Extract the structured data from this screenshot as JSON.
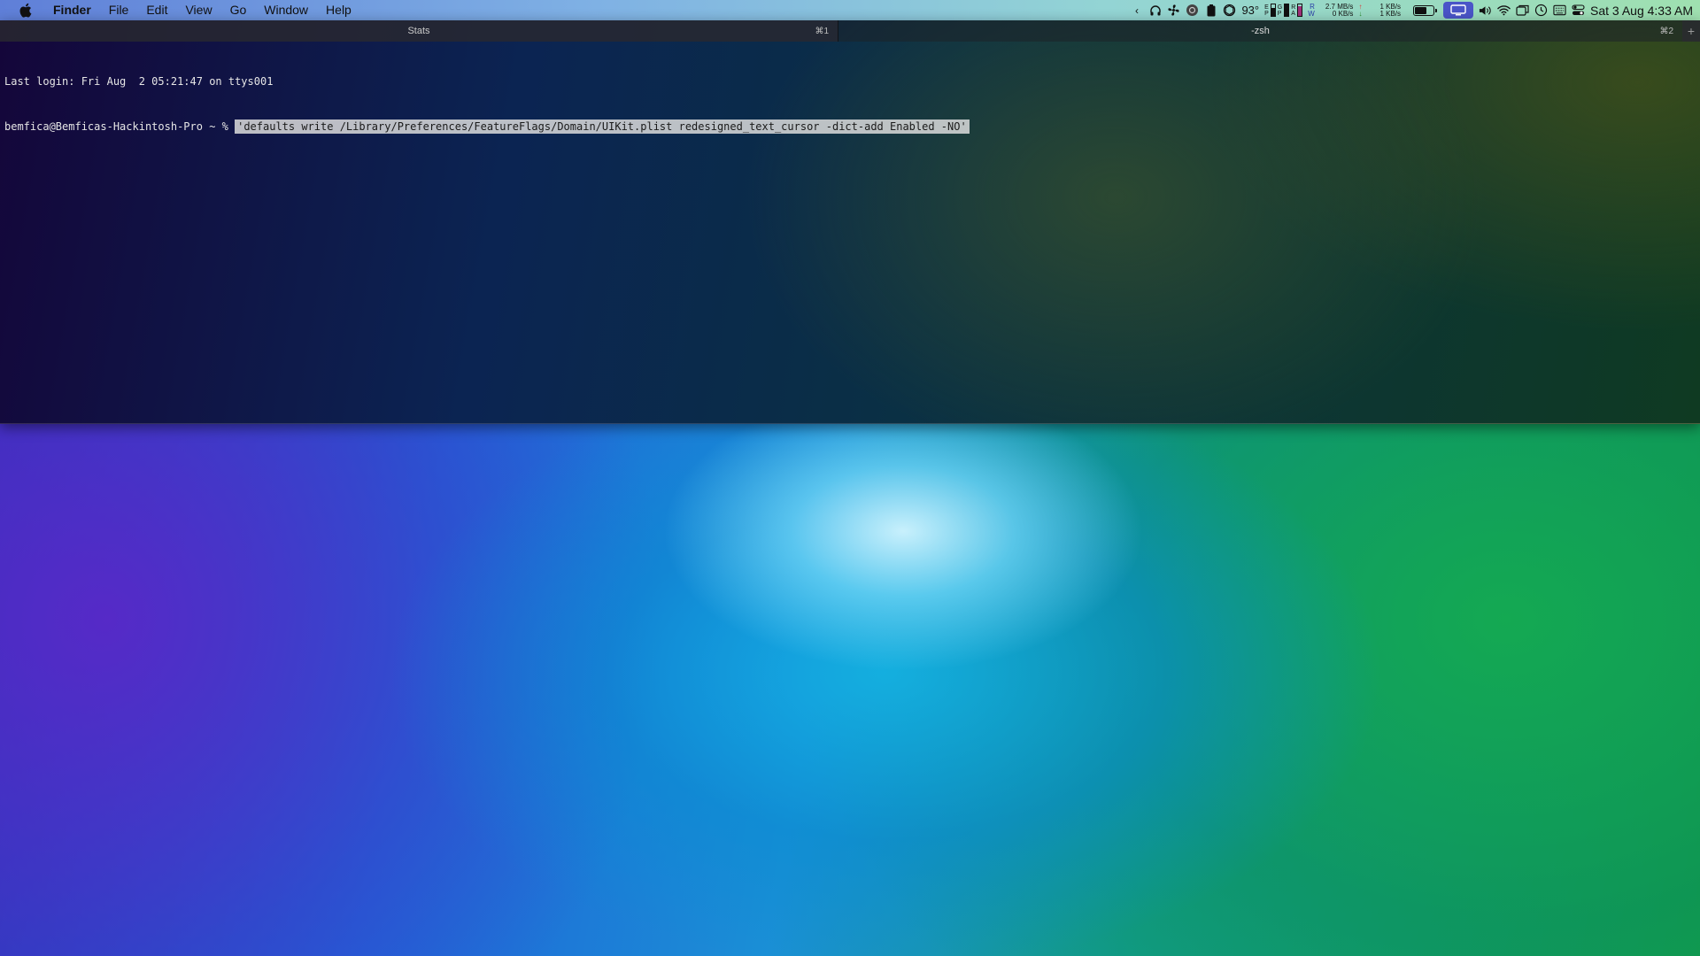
{
  "menubar": {
    "app_name": "Finder",
    "items": [
      "File",
      "Edit",
      "View",
      "Go",
      "Window",
      "Help"
    ],
    "status": {
      "temperature": "93°",
      "network_up": "2.7 MB/s",
      "network_down": "0 KB/s",
      "disk_read": "1 KB/s",
      "disk_write": "1 KB/s",
      "mem_labels": [
        "R",
        "W"
      ],
      "clock": "Sat 3 Aug  4:33 AM"
    },
    "icons": [
      "chevron-left-icon",
      "headphones-icon",
      "fan-icon",
      "gpu-icon",
      "battery-small-icon",
      "chatgpt-icon",
      "cpu-bars-icon",
      "battery-icon",
      "display-icon",
      "volume-icon",
      "wifi-icon",
      "window-icon",
      "time-machine-icon",
      "keyboard-icon",
      "control-center-icon"
    ]
  },
  "terminal": {
    "tabs": [
      {
        "title": "Stats",
        "shortcut": "⌘1",
        "active": false
      },
      {
        "title": "-zsh",
        "shortcut": "⌘2",
        "active": true
      }
    ],
    "new_tab_label": "+",
    "lines": {
      "login": "Last login: Fri Aug  2 05:21:47 on ttys001",
      "prompt": "bemfica@Bemficas-Hackintosh-Pro ~ % ",
      "command": "'defaults write /Library/Preferences/FeatureFlags/Domain/UIKit.plist redesigned_text_cursor -dict-add Enabled -NO'"
    }
  }
}
